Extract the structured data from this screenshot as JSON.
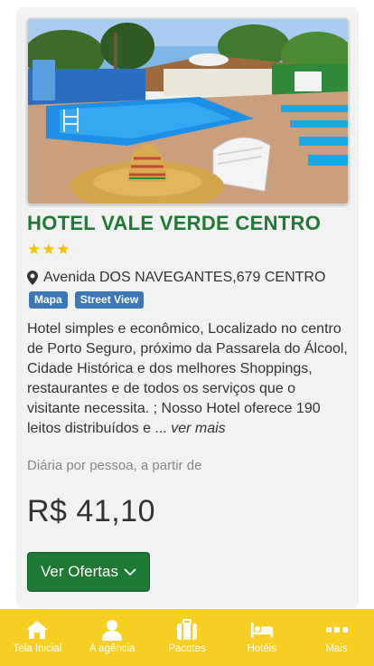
{
  "hotel": {
    "name": "HOTEL VALE VERDE CENTRO",
    "stars": "★★★",
    "address": "Avenida DOS NAVEGANTES,679 CENTRO",
    "tags": {
      "map": "Mapa",
      "street_view": "Street View"
    },
    "description": "Hotel simples e econômico, Localizado no centro de Porto Seguro, próximo da Passarela do Álcool, Cidade Histórica e dos melhores Shoppings, restaurantes e de todos os serviços que o visitante necessita. ; Nosso Hotel oferece 190 leitos distribuídos e ... ",
    "more_link": "ver mais",
    "price_note": "Diária por pessoa, a partir de",
    "price": "R$ 41,10",
    "cta_label": "Ver Ofertas"
  },
  "tabbar": {
    "items": [
      {
        "label": "Tela Inicial",
        "icon": "home-icon"
      },
      {
        "label": "A agência",
        "icon": "user-icon"
      },
      {
        "label": "Pacotes",
        "icon": "suitcase-icon"
      },
      {
        "label": "Hotéis",
        "icon": "bed-icon"
      },
      {
        "label": "Mais",
        "icon": "more-dots-icon"
      }
    ]
  },
  "colors": {
    "title_green": "#1e7a33",
    "button_green": "#1e7a33",
    "tag_blue": "#3c78b8",
    "tabbar_yellow": "#f7cf22",
    "star_yellow": "#f5c400"
  }
}
